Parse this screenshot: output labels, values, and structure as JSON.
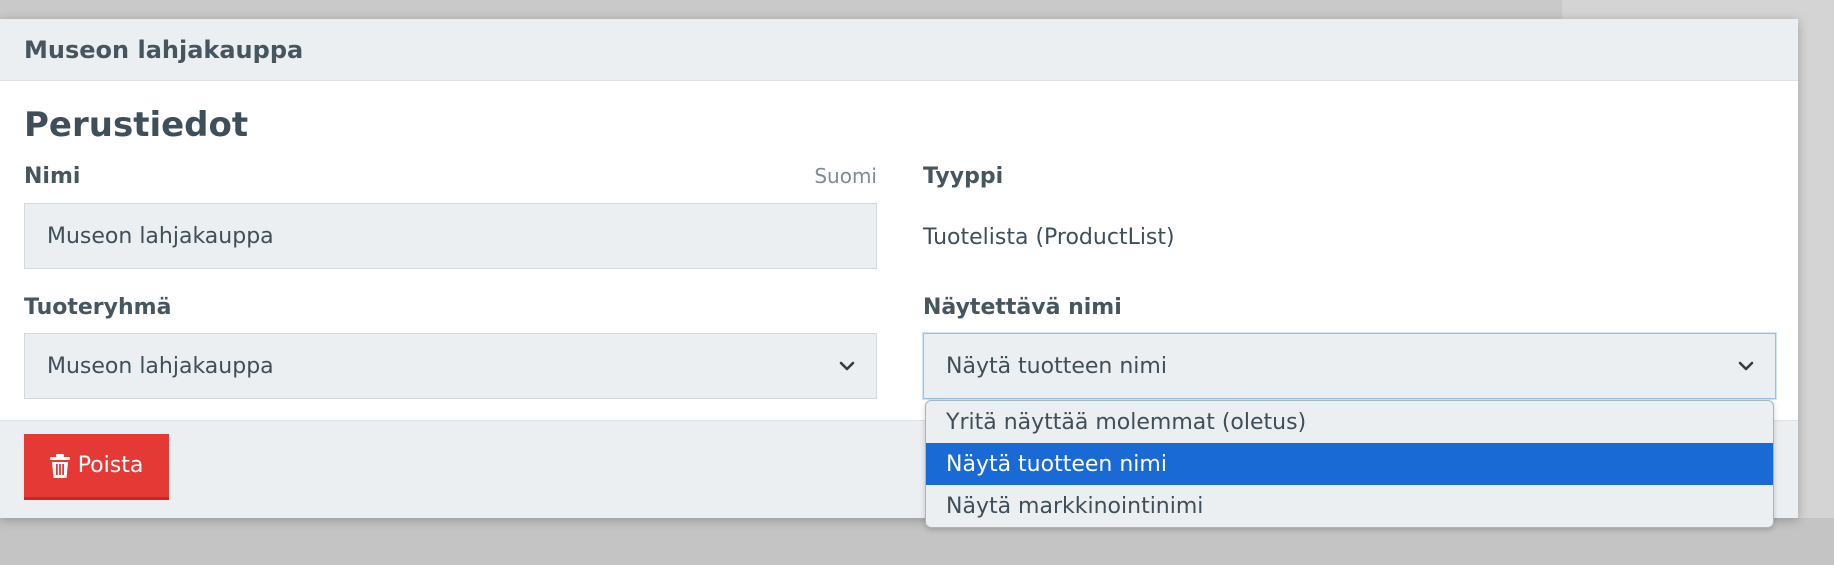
{
  "modal": {
    "title": "Museon lahjakauppa",
    "section_title": "Perustiedot"
  },
  "fields": {
    "name": {
      "label": "Nimi",
      "language": "Suomi",
      "value": "Museon lahjakauppa"
    },
    "type": {
      "label": "Tyyppi",
      "value": "Tuotelista (ProductList)"
    },
    "product_group": {
      "label": "Tuoteryhmä",
      "selected": "Museon lahjakauppa"
    },
    "display_name": {
      "label": "Näytettävä nimi",
      "selected": "Näytä tuotteen nimi",
      "options": [
        "Yritä näyttää molemmat (oletus)",
        "Näytä tuotteen nimi",
        "Näytä markkinointinimi"
      ],
      "selected_index": 1
    }
  },
  "footer": {
    "delete_label": "Poista"
  },
  "icons": {
    "chevron": "chevron-down-icon",
    "trash": "trash-icon"
  },
  "colors": {
    "danger": "#e53935",
    "selected_option": "#1a6ad6",
    "focus_border": "#8bc4f0"
  }
}
